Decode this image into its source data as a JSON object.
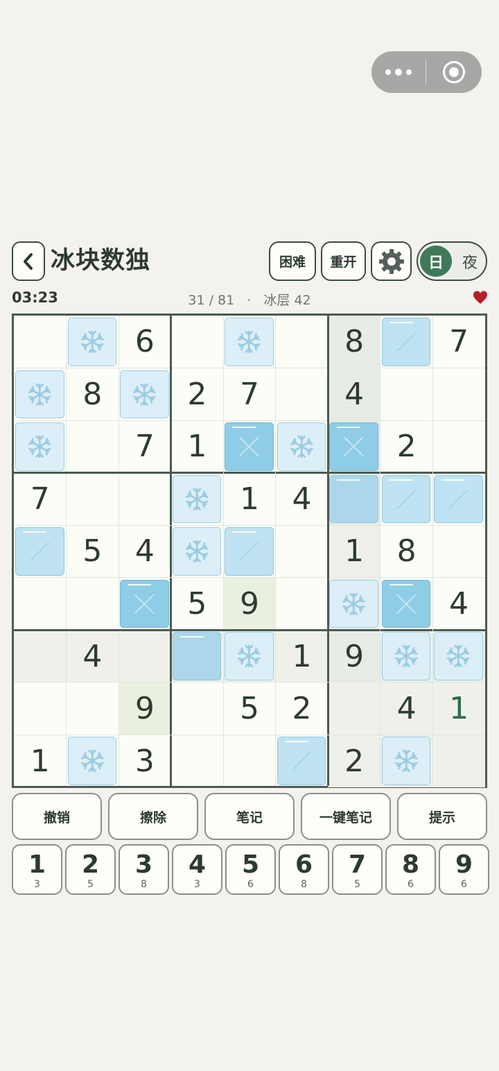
{
  "header": {
    "title": "冰块数独",
    "difficulty_label": "困难",
    "restart_label": "重开",
    "day_label": "日",
    "night_label": "夜"
  },
  "status": {
    "timer": "03:23",
    "filled": "31 / 81",
    "separator": "·",
    "ice_label": "冰层 42",
    "heart_color": "#b3202c"
  },
  "board": {
    "cells": [
      [
        "",
        "",
        "6",
        "",
        "",
        "",
        "8",
        "",
        "7"
      ],
      [
        "",
        "8",
        "",
        "2",
        "7",
        "",
        "4",
        "",
        ""
      ],
      [
        "",
        "",
        "7",
        "1",
        "",
        "",
        "",
        "2",
        ""
      ],
      [
        "7",
        "",
        "",
        "",
        "1",
        "4",
        "",
        "",
        ""
      ],
      [
        "",
        "5",
        "4",
        "",
        "",
        "",
        "1",
        "8",
        ""
      ],
      [
        "",
        "",
        "",
        "5",
        "9",
        "",
        "",
        "",
        "4"
      ],
      [
        "",
        "4",
        "",
        "",
        "",
        "1",
        "9",
        "",
        ""
      ],
      [
        "",
        "",
        "9",
        "",
        "5",
        "2",
        "",
        "4",
        "1"
      ],
      [
        "1",
        "",
        "3",
        "",
        "",
        "",
        "2",
        "",
        ""
      ]
    ],
    "ice": [
      [
        "",
        "snow",
        "",
        "",
        "snow",
        "",
        "",
        "crack",
        ""
      ],
      [
        "snow",
        "",
        "snow",
        "",
        "",
        "",
        "",
        "",
        ""
      ],
      [
        "snow",
        "",
        "",
        "",
        "solid",
        "snow",
        "solid",
        "",
        ""
      ],
      [
        "",
        "",
        "",
        "snow",
        "",
        "",
        "crackdeep",
        "crack",
        "crack"
      ],
      [
        "crack",
        "",
        "",
        "snow",
        "crack",
        "",
        "",
        "",
        ""
      ],
      [
        "",
        "",
        "solid",
        "",
        "",
        "",
        "snow",
        "solid",
        ""
      ],
      [
        "",
        "",
        "",
        "crackdeep",
        "snow",
        "",
        "",
        "snow",
        "snow"
      ],
      [
        "",
        "",
        "",
        "",
        "",
        "",
        "",
        "",
        ""
      ],
      [
        "",
        "snow",
        "",
        "",
        "",
        "crack",
        "",
        "snow",
        ""
      ]
    ],
    "highlight": [
      [
        "",
        "",
        "",
        "",
        "",
        "",
        "hl2",
        "",
        ""
      ],
      [
        "",
        "",
        "",
        "",
        "",
        "",
        "hl2",
        "",
        ""
      ],
      [
        "",
        "",
        "",
        "",
        "",
        "",
        "hl2",
        "",
        ""
      ],
      [
        "",
        "",
        "",
        "",
        "",
        "",
        "hl2",
        "",
        ""
      ],
      [
        "",
        "",
        "",
        "",
        "",
        "",
        "hl",
        "",
        ""
      ],
      [
        "",
        "",
        "",
        "",
        "hlg",
        "",
        "hl",
        "",
        ""
      ],
      [
        "hl",
        "hl",
        "hl",
        "hl",
        "hl",
        "hl",
        "hl2",
        "hl",
        "hl"
      ],
      [
        "",
        "",
        "hlg",
        "",
        "",
        "",
        "hl",
        "hl",
        "hl"
      ],
      [
        "",
        "",
        "",
        "",
        "",
        "",
        "hl",
        "hl",
        "hl"
      ]
    ],
    "green_digits": [
      [
        7,
        8
      ]
    ],
    "colors": {
      "grid_bold": "#4a5a52",
      "ice_light": "#dceff8",
      "ice_cracked": "#bfe3f2",
      "ice_solid": "#8fcde6",
      "highlight": "#eef0e9"
    }
  },
  "actions": [
    "撤销",
    "擦除",
    "笔记",
    "一键笔记",
    "提示"
  ],
  "numpad": [
    {
      "digit": "1",
      "count": "3"
    },
    {
      "digit": "2",
      "count": "5"
    },
    {
      "digit": "3",
      "count": "8"
    },
    {
      "digit": "4",
      "count": "3"
    },
    {
      "digit": "5",
      "count": "6"
    },
    {
      "digit": "6",
      "count": "8"
    },
    {
      "digit": "7",
      "count": "5"
    },
    {
      "digit": "8",
      "count": "6"
    },
    {
      "digit": "9",
      "count": "6"
    }
  ],
  "icons": {
    "back": "chevron-left-icon",
    "settings": "gear-icon",
    "heart": "heart-icon",
    "snow": "snowflake-icon",
    "more": "more-dots-icon",
    "close_target": "target-icon"
  }
}
